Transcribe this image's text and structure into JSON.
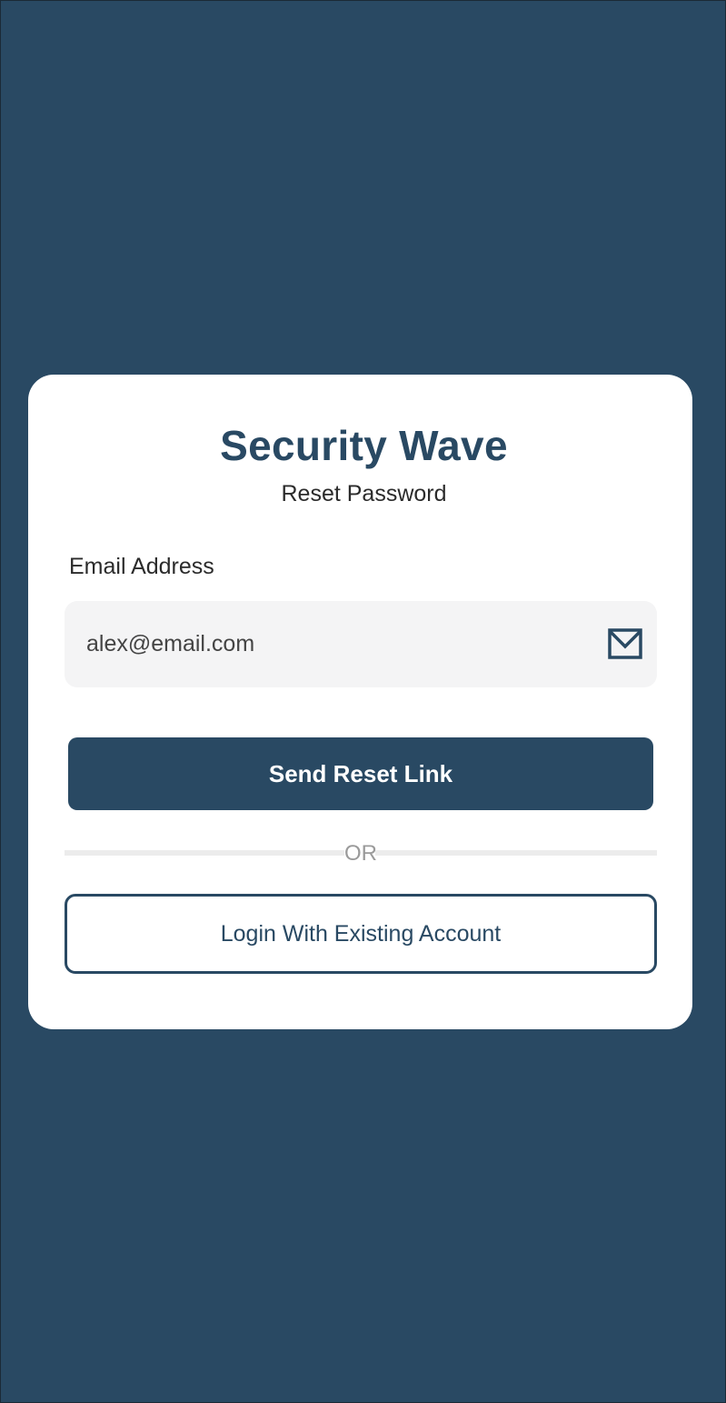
{
  "app": {
    "title": "Security Wave",
    "subtitle": "Reset Password"
  },
  "form": {
    "email_label": "Email Address",
    "email_value": "alex@email.com",
    "email_icon": "mail-icon"
  },
  "actions": {
    "send_reset_label": "Send Reset Link",
    "divider_text": "OR",
    "login_label": "Login With Existing Account"
  },
  "colors": {
    "background": "#294963",
    "card": "#ffffff",
    "primary": "#294963",
    "input_bg": "#f4f4f5",
    "divider": "#ececec",
    "muted_text": "#9a9a9a"
  }
}
